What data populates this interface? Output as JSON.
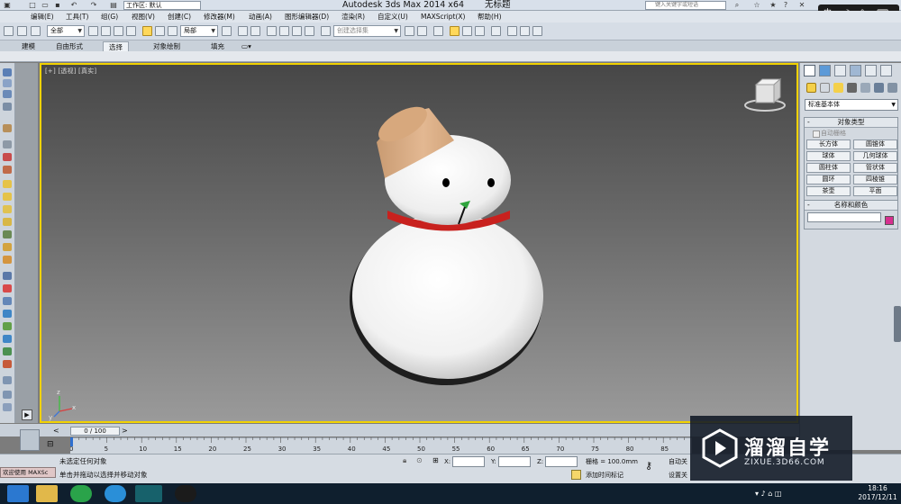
{
  "window": {
    "workspace": "工作区: 默认",
    "title": "Autodesk 3ds Max  2014 x64",
    "document": "无标题",
    "search_placeholder": "键入关键字或短语"
  },
  "ime": {
    "label": "中"
  },
  "menu": [
    "编辑(E)",
    "工具(T)",
    "组(G)",
    "视图(V)",
    "创建(C)",
    "修改器(M)",
    "动画(A)",
    "图形编辑器(D)",
    "渲染(R)",
    "自定义(U)",
    "MAXScript(X)",
    "帮助(H)"
  ],
  "toolbar": {
    "selection_filter": "全部",
    "coord_system": "局部",
    "named_selection_placeholder": "创建选择集"
  },
  "ribbon": {
    "tabs": [
      "建模",
      "自由形式",
      "选择",
      "对象绘制",
      "填充"
    ],
    "active_tab": "选择"
  },
  "viewport": {
    "label": "[+] [透视] [真实]",
    "border_color": "#f2d200",
    "axis": {
      "x": "x",
      "y": "y",
      "z": "z"
    }
  },
  "command_panel": {
    "category": "标准基本体",
    "object_type_title": "对象类型",
    "auto_grid": "自动栅格",
    "objects": [
      "长方体",
      "圆锥体",
      "球体",
      "几何球体",
      "圆柱体",
      "管状体",
      "圆环",
      "四棱锥",
      "茶壶",
      "平面"
    ],
    "name_color_title": "名称和颜色",
    "object_color": "#d6308f"
  },
  "timeline": {
    "frame_display": "0 / 100",
    "ticks": [
      "0",
      "5",
      "10",
      "15",
      "20",
      "25",
      "30",
      "35",
      "40",
      "45",
      "50",
      "55",
      "60",
      "65",
      "70",
      "75",
      "80",
      "85"
    ]
  },
  "status": {
    "welcome": "欢迎使用 MAXSc",
    "selection": "未选定任何对象",
    "prompt": "单击并拖动以选择并移动对象",
    "x_label": "X:",
    "y_label": "Y:",
    "z_label": "Z:",
    "grid": "栅格 = 100.0mm",
    "add_time_tag": "添加时间标记",
    "auto_key": "自动关",
    "set_key": "设置关"
  },
  "taskbar": {
    "time": "18:16",
    "date": "2017/12/11"
  },
  "watermark": {
    "title": "溜溜自学",
    "subtitle": "ZIXUE.3D66.COM"
  }
}
